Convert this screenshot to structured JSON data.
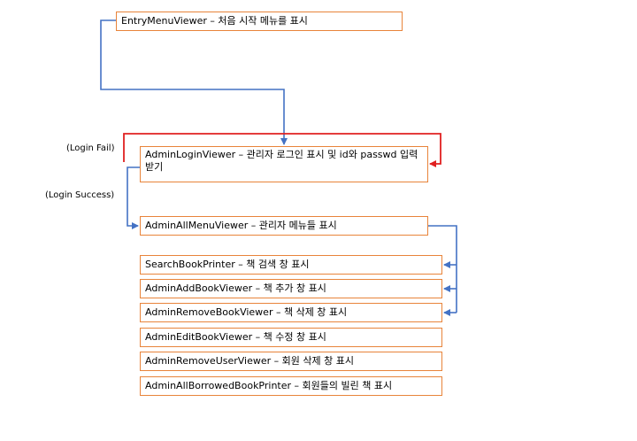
{
  "boxes": {
    "entry": "EntryMenuViewer – 처음 시작 메뉴를 표시",
    "admin_login": "AdminLoginViewer – 관리자 로그인 표시 및 id와 passwd 입력받기",
    "admin_all_menu": "AdminAllMenuViewer – 관리자 메뉴들 표시",
    "search_book": "SearchBookPrinter – 책 검색 창 표시",
    "add_book": "AdminAddBookViewer – 책 추가 창 표시",
    "remove_book": "AdminRemoveBookViewer – 책 삭제 창 표시",
    "edit_book": "AdminEditBookViewer – 책 수정 창 표시",
    "remove_user": "AdminRemoveUserViewer – 회원 삭제 창 표시",
    "all_borrowed": "AdminAllBorrowedBookPrinter – 회원들의 빌린 책 표시"
  },
  "labels": {
    "login_fail": "(Login Fail)",
    "login_success": "(Login Success)"
  },
  "colors": {
    "box_border": "#e8843a",
    "arrow_blue": "#4472c4",
    "arrow_red": "#e02020"
  }
}
